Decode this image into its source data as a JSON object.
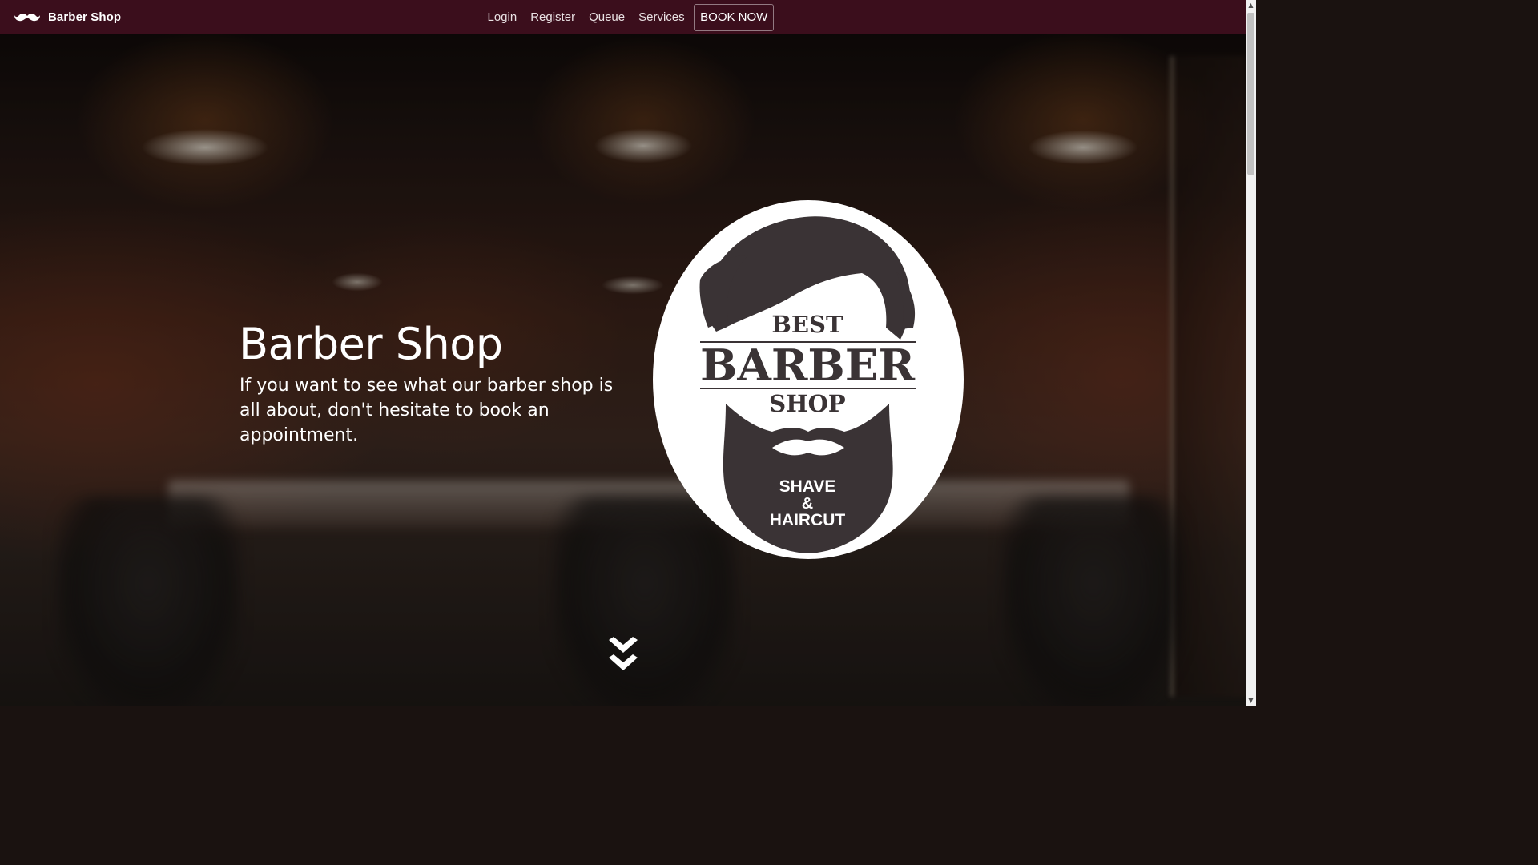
{
  "navbar": {
    "brand": "Barber Shop",
    "brand_icon": "mustache-icon",
    "links": [
      "Login",
      "Register",
      "Queue",
      "Services"
    ],
    "cta": "BOOK NOW",
    "background": "#3b0e1c"
  },
  "hero": {
    "title": "Barber Shop",
    "text": "If you want to see what our barber shop is all about, don't hesitate to book an appointment.",
    "scroll_icon": "double-chevron-down-icon"
  },
  "logo": {
    "line1": "BEST",
    "line2": "BARBER",
    "line3": "SHOP",
    "beard_line1": "SHAVE",
    "beard_line2": "&",
    "beard_line3": "HAIRCUT",
    "ink": "#3a3335"
  }
}
